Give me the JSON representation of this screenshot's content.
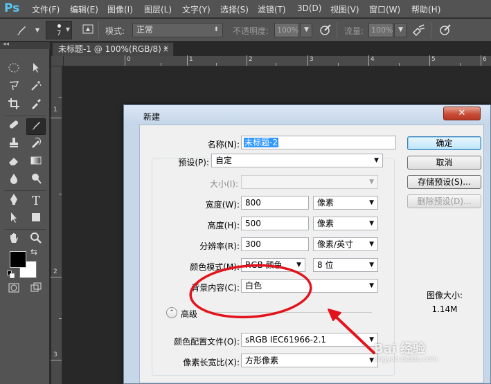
{
  "app": {
    "logo": "Ps"
  },
  "menu": [
    "文件(F)",
    "编辑(E)",
    "图像(I)",
    "图层(L)",
    "文字(Y)",
    "选择(S)",
    "滤镜(T)",
    "3D(D)",
    "视图(V)",
    "窗口(W)",
    "帮助(H)"
  ],
  "options": {
    "brush_size": "7",
    "mode_label": "模式:",
    "mode_value": "正常",
    "opacity_label": "不透明度:",
    "opacity_value": "100%",
    "flow_label": "流量:",
    "flow_value": "100%"
  },
  "document": {
    "tab_title": "未标题-1 @ 100%(RGB/8) *",
    "tab_close": "×",
    "ruler_h_numbers": [
      "0",
      "1",
      "2",
      "3",
      "4",
      "5",
      "6",
      "7"
    ],
    "ruler_v_numbers": [
      "1",
      "2",
      "3"
    ]
  },
  "tools": {
    "text_tool": "T"
  },
  "dialog": {
    "title": "新建",
    "close": "✕",
    "name_label": "名称(N):",
    "name_value": "未标题-2",
    "preset_label": "预设(P):",
    "preset_value": "自定",
    "size_label": "大小(I):",
    "width_label": "宽度(W):",
    "width_value": "800",
    "width_unit": "像素",
    "height_label": "高度(H):",
    "height_value": "500",
    "height_unit": "像素",
    "resolution_label": "分辨率(R):",
    "resolution_value": "300",
    "resolution_unit": "像素/英寸",
    "color_mode_label": "颜色模式(M):",
    "color_mode_value": "RGB 颜色",
    "bit_depth_value": "8 位",
    "background_label": "背景内容(C):",
    "background_value": "白色",
    "advanced_label": "高级",
    "advanced_toggle": "⌃",
    "color_profile_label": "颜色配置文件(O):",
    "color_profile_value": "sRGB IEC61966-2.1",
    "pixel_aspect_label": "像素长宽比(X):",
    "pixel_aspect_value": "方形像素",
    "btn_ok": "确定",
    "btn_cancel": "取消",
    "btn_save_preset": "存储预设(S)...",
    "btn_delete_preset": "删除预设(D)...",
    "image_size_label": "图像大小:",
    "image_size_value": "1.14M"
  },
  "watermark": {
    "text": "Bai 经验",
    "sub": "jingyan.baidu.com"
  },
  "colors": {
    "foreground": "#000000",
    "background": "#ffffff",
    "annotation": "#e3131b",
    "ps_blue": "#58c7f0"
  }
}
